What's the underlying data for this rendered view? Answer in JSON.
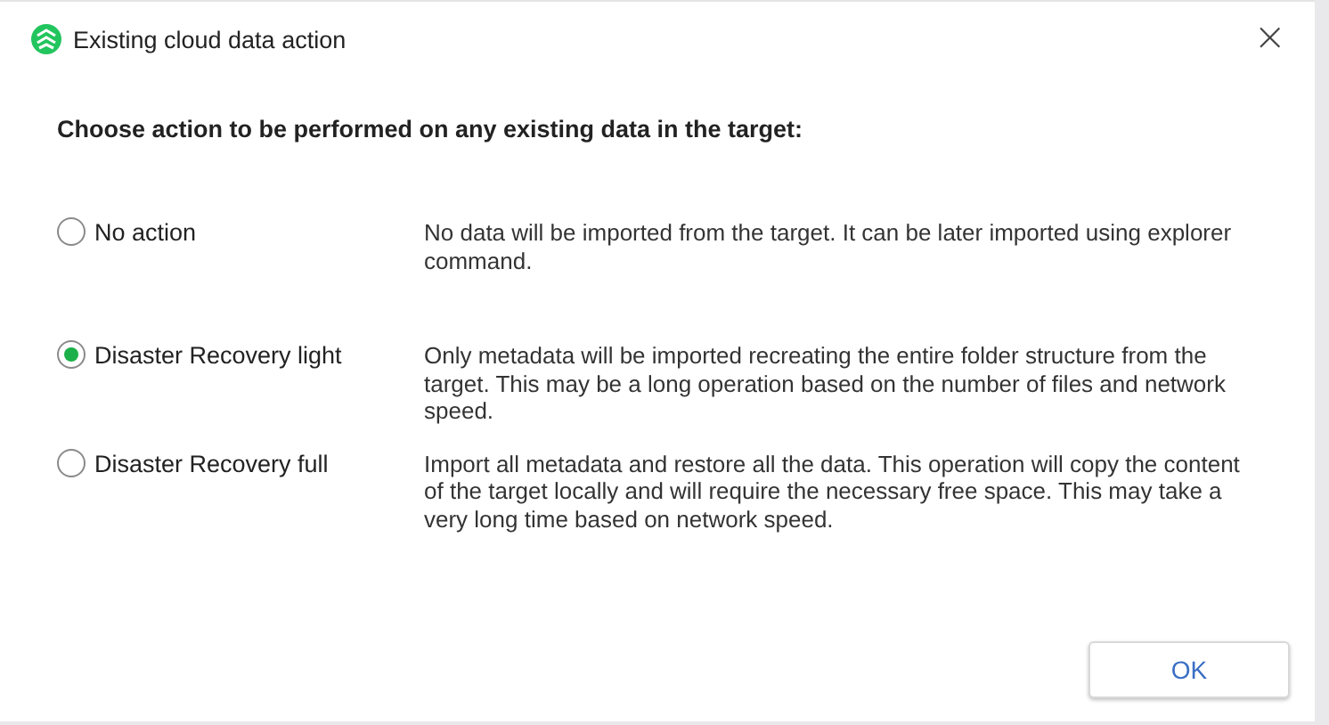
{
  "window": {
    "title": "Existing cloud data action"
  },
  "heading": "Choose action to be performed on any existing data in the target:",
  "options": [
    {
      "label": "No action",
      "selected": false,
      "description": "No data will be imported from the target. It can be later imported using explorer command."
    },
    {
      "label": "Disaster Recovery light",
      "selected": true,
      "description": "Only metadata will be imported recreating the entire folder structure from the target. This may be a long operation based on the number of files and network speed."
    },
    {
      "label": "Disaster Recovery full",
      "selected": false,
      "description": "Import all metadata and restore all the data. This operation will copy the content of the target locally and will require the necessary free space. This may take a very long time based on network speed."
    }
  ],
  "buttons": [
    "OK"
  ],
  "close_button": "×"
}
